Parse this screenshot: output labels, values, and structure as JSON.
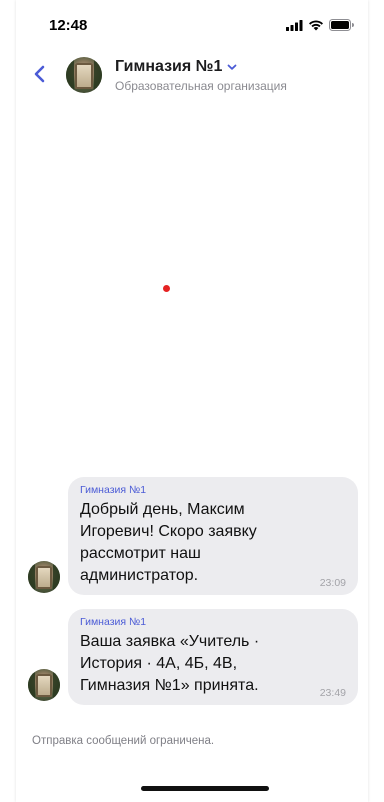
{
  "status_bar": {
    "time": "12:48",
    "icons": [
      "signal-icon",
      "wifi-icon",
      "battery-icon"
    ]
  },
  "header": {
    "back_icon": "chevron-left-icon",
    "title": "Гимназия №1",
    "title_dropdown_icon": "chevron-down-icon",
    "subtitle": "Образовательная организация"
  },
  "messages": [
    {
      "sender": "Гимназия №1",
      "text": "Добрый день, Максим Игоревич! Скоро заявку рассмотрит наш администратор.",
      "time": "23:09"
    },
    {
      "sender": "Гимназия №1",
      "text": "Ваша заявка «Учитель · История · 4А, 4Б, 4В, Гимназия №1» принята.",
      "time": "23:49"
    }
  ],
  "footer": {
    "notice": "Отправка сообщений ограничена."
  },
  "colors": {
    "accent": "#4b5bd6",
    "bubble": "#ececef",
    "notification_dot": "#e52222"
  }
}
